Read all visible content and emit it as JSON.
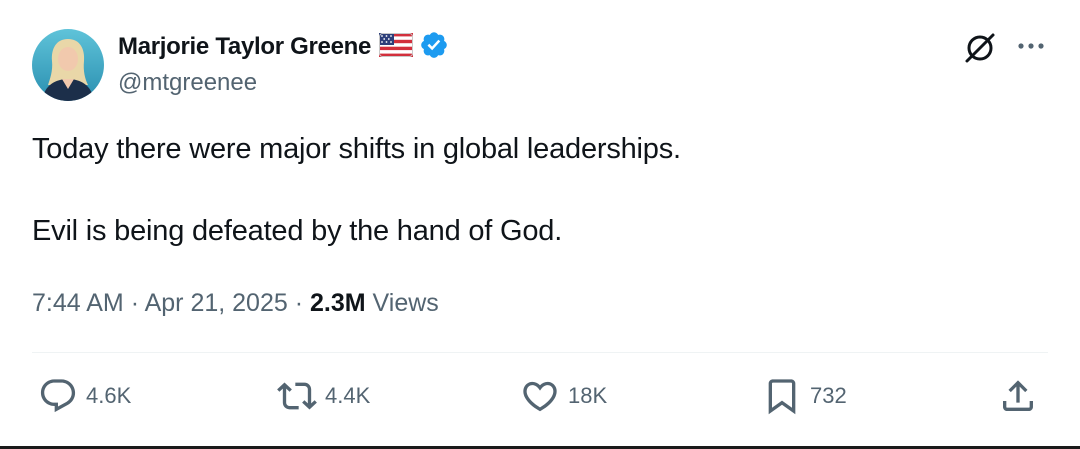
{
  "author": {
    "name": "Marjorie Taylor Greene",
    "handle": "@mtgreenee",
    "flag_icon": "us-flag-icon",
    "verified_color": "#1d9bf0"
  },
  "tweet": {
    "lines": [
      "Today there were major shifts in global leaderships.",
      "Evil is being defeated by the hand of God."
    ]
  },
  "meta": {
    "time": "7:44 AM",
    "separator": "·",
    "date": "Apr 21, 2025",
    "views_count": "2.3M",
    "views_label": "Views"
  },
  "actions": {
    "replies": "4.6K",
    "reposts": "4.4K",
    "likes": "18K",
    "bookmarks": "732"
  },
  "colors": {
    "text_primary": "#0f1419",
    "text_secondary": "#536471",
    "verified": "#1d9bf0"
  }
}
